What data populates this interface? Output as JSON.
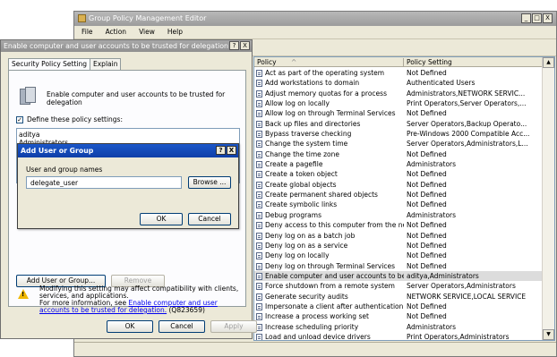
{
  "main_window": {
    "title": "Group Policy Management Editor",
    "controls": [
      "_",
      "□",
      "X"
    ],
    "menu": [
      "File",
      "Action",
      "View",
      "Help"
    ]
  },
  "policy_list": {
    "columns": [
      "Policy",
      "Policy Setting"
    ],
    "sort_indicator": "^",
    "rows": [
      {
        "name": "Act as part of the operating system",
        "setting": "Not Defined"
      },
      {
        "name": "Add workstations to domain",
        "setting": "Authenticated Users"
      },
      {
        "name": "Adjust memory quotas for a process",
        "setting": "Administrators,NETWORK SERVIC..."
      },
      {
        "name": "Allow log on locally",
        "setting": "Print Operators,Server Operators,..."
      },
      {
        "name": "Allow log on through Terminal Services",
        "setting": "Not Defined"
      },
      {
        "name": "Back up files and directories",
        "setting": "Server Operators,Backup Operato..."
      },
      {
        "name": "Bypass traverse checking",
        "setting": "Pre-Windows 2000 Compatible Acc..."
      },
      {
        "name": "Change the system time",
        "setting": "Server Operators,Administrators,L..."
      },
      {
        "name": "Change the time zone",
        "setting": "Not Defined"
      },
      {
        "name": "Create a pagefile",
        "setting": "Administrators"
      },
      {
        "name": "Create a token object",
        "setting": "Not Defined"
      },
      {
        "name": "Create global objects",
        "setting": "Not Defined"
      },
      {
        "name": "Create permanent shared objects",
        "setting": "Not Defined"
      },
      {
        "name": "Create symbolic links",
        "setting": "Not Defined"
      },
      {
        "name": "Debug programs",
        "setting": "Administrators"
      },
      {
        "name": "Deny access to this computer from the netw...",
        "setting": "Not Defined"
      },
      {
        "name": "Deny log on as a batch job",
        "setting": "Not Defined"
      },
      {
        "name": "Deny log on as a service",
        "setting": "Not Defined"
      },
      {
        "name": "Deny log on locally",
        "setting": "Not Defined"
      },
      {
        "name": "Deny log on through Terminal Services",
        "setting": "Not Defined"
      },
      {
        "name": "Enable computer and user accounts to be tr...",
        "setting": "aditya,Administrators",
        "selected": true
      },
      {
        "name": "Force shutdown from a remote system",
        "setting": "Server Operators,Administrators"
      },
      {
        "name": "Generate security audits",
        "setting": "NETWORK SERVICE,LOCAL SERVICE"
      },
      {
        "name": "Impersonate a client after authentication",
        "setting": "Not Defined"
      },
      {
        "name": "Increase a process working set",
        "setting": "Not Defined"
      },
      {
        "name": "Increase scheduling priority",
        "setting": "Administrators"
      },
      {
        "name": "Load and unload device drivers",
        "setting": "Print Operators,Administrators"
      }
    ]
  },
  "properties_dialog": {
    "title": "Enable computer and user accounts to be trusted for delegation ...",
    "title_buttons": [
      "?",
      "X"
    ],
    "tabs": [
      "Security Policy Setting",
      "Explain"
    ],
    "heading": "Enable computer and user accounts to be trusted for delegation",
    "define_checkbox_label": "Define these policy settings:",
    "define_checked": true,
    "users": [
      "aditya",
      "Administrators"
    ],
    "add_button": "Add User or Group...",
    "remove_button": "Remove",
    "warning_text": "Modifying this setting may affect compatibility with clients, services, and applications.",
    "more_info_prefix": "For more information, see",
    "more_info_link": "Enable computer and user accounts to be trusted for delegation.",
    "more_info_suffix": "(Q823659)",
    "ok_button": "OK",
    "cancel_button": "Cancel",
    "apply_button": "Apply"
  },
  "add_user_dialog": {
    "title": "Add User or Group",
    "title_buttons": [
      "?",
      "X"
    ],
    "field_label": "User and group names",
    "field_value": "delegate_user",
    "browse_button": "Browse ...",
    "ok_button": "OK",
    "cancel_button": "Cancel"
  },
  "colors": {
    "active_titlebar": "#1b57c9",
    "inactive_titlebar": "#a0a0a0",
    "dialog_face": "#ece9d8",
    "link": "#0000ee",
    "selected_row": "#dcdcdc"
  }
}
